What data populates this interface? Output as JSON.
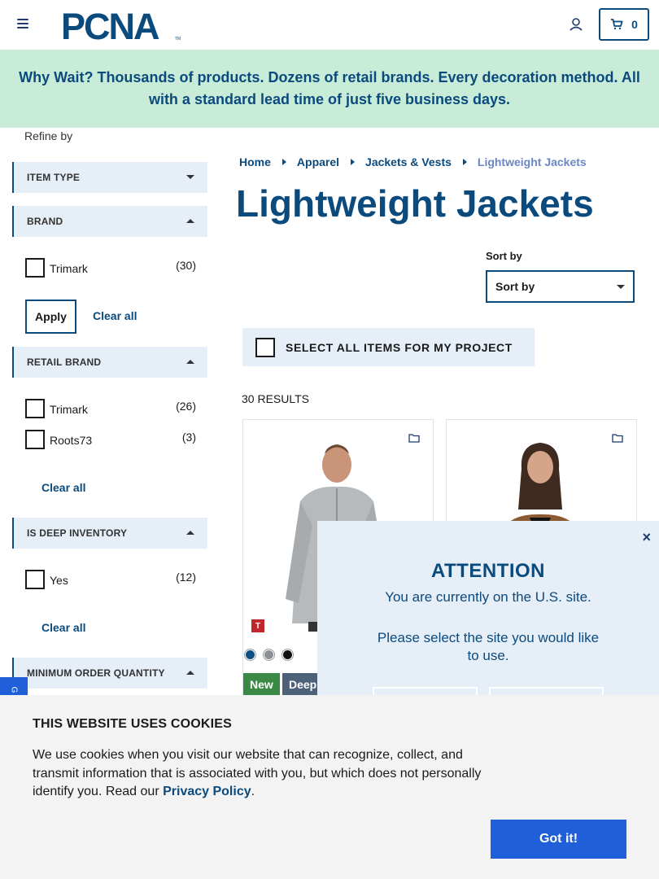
{
  "header": {
    "logo_text": "PCNA",
    "cart_count": "0"
  },
  "banner": {
    "text": "Why Wait? Thousands of products. Dozens of retail brands. Every decoration method. All with a standard lead time of just five business days."
  },
  "sidebar": {
    "refine_label": "Refine by",
    "facets": {
      "item_type": {
        "title": "ITEM TYPE"
      },
      "brand": {
        "title": "BRAND",
        "options": [
          {
            "label": "Trimark",
            "count": "(30)"
          }
        ],
        "apply_label": "Apply",
        "clear_label": "Clear all"
      },
      "retail_brand": {
        "title": "RETAIL BRAND",
        "options": [
          {
            "label": "Trimark",
            "count": "(26)"
          },
          {
            "label": "Roots73",
            "count": "(3)"
          }
        ],
        "clear_label": "Clear all"
      },
      "deep_inventory": {
        "title": "IS DEEP INVENTORY",
        "options": [
          {
            "label": "Yes",
            "count": "(12)"
          }
        ],
        "clear_label": "Clear all"
      },
      "min_order": {
        "title": "MINIMUM ORDER QUANTITY"
      }
    }
  },
  "breadcrumb": {
    "items": [
      "Home",
      "Apparel",
      "Jackets & Vests"
    ],
    "current": "Lightweight Jackets"
  },
  "page_title": "Lightweight Jackets",
  "sort": {
    "label": "Sort by",
    "selected": "Sort by"
  },
  "select_all_label": "SELECT ALL ITEMS FOR MY PROJECT",
  "results_count": "30 RESULTS",
  "products": [
    {
      "brand_mark": "T",
      "swatch_colors": [
        "#0e4f86",
        "#8c8f93",
        "#111111"
      ],
      "badges": [
        {
          "label": "New",
          "color": "#3a8a45"
        },
        {
          "label": "Deep",
          "color": "#4d6278"
        }
      ]
    },
    {
      "brand_mark": "",
      "swatch_colors": [],
      "badges": []
    }
  ],
  "attention": {
    "title": "ATTENTION",
    "line1": "You are currently on the U.S. site.",
    "line2": "Please select the site you would like to use.",
    "close": "×"
  },
  "cookie": {
    "title": "THIS WEBSITE USES COOKIES",
    "body": "We use cookies when you visit our website that can recognize, collect, and transmit information that is associated with you, but which does not personally identify you. Read our ",
    "policy_link": "Privacy Policy",
    "period": ".",
    "button": "Got it!"
  },
  "colors": {
    "brand_blue": "#0b4a7d",
    "banner_bg": "#c8ecd8",
    "facet_bg": "#e6eef7",
    "cta_blue": "#1f5fd9"
  }
}
